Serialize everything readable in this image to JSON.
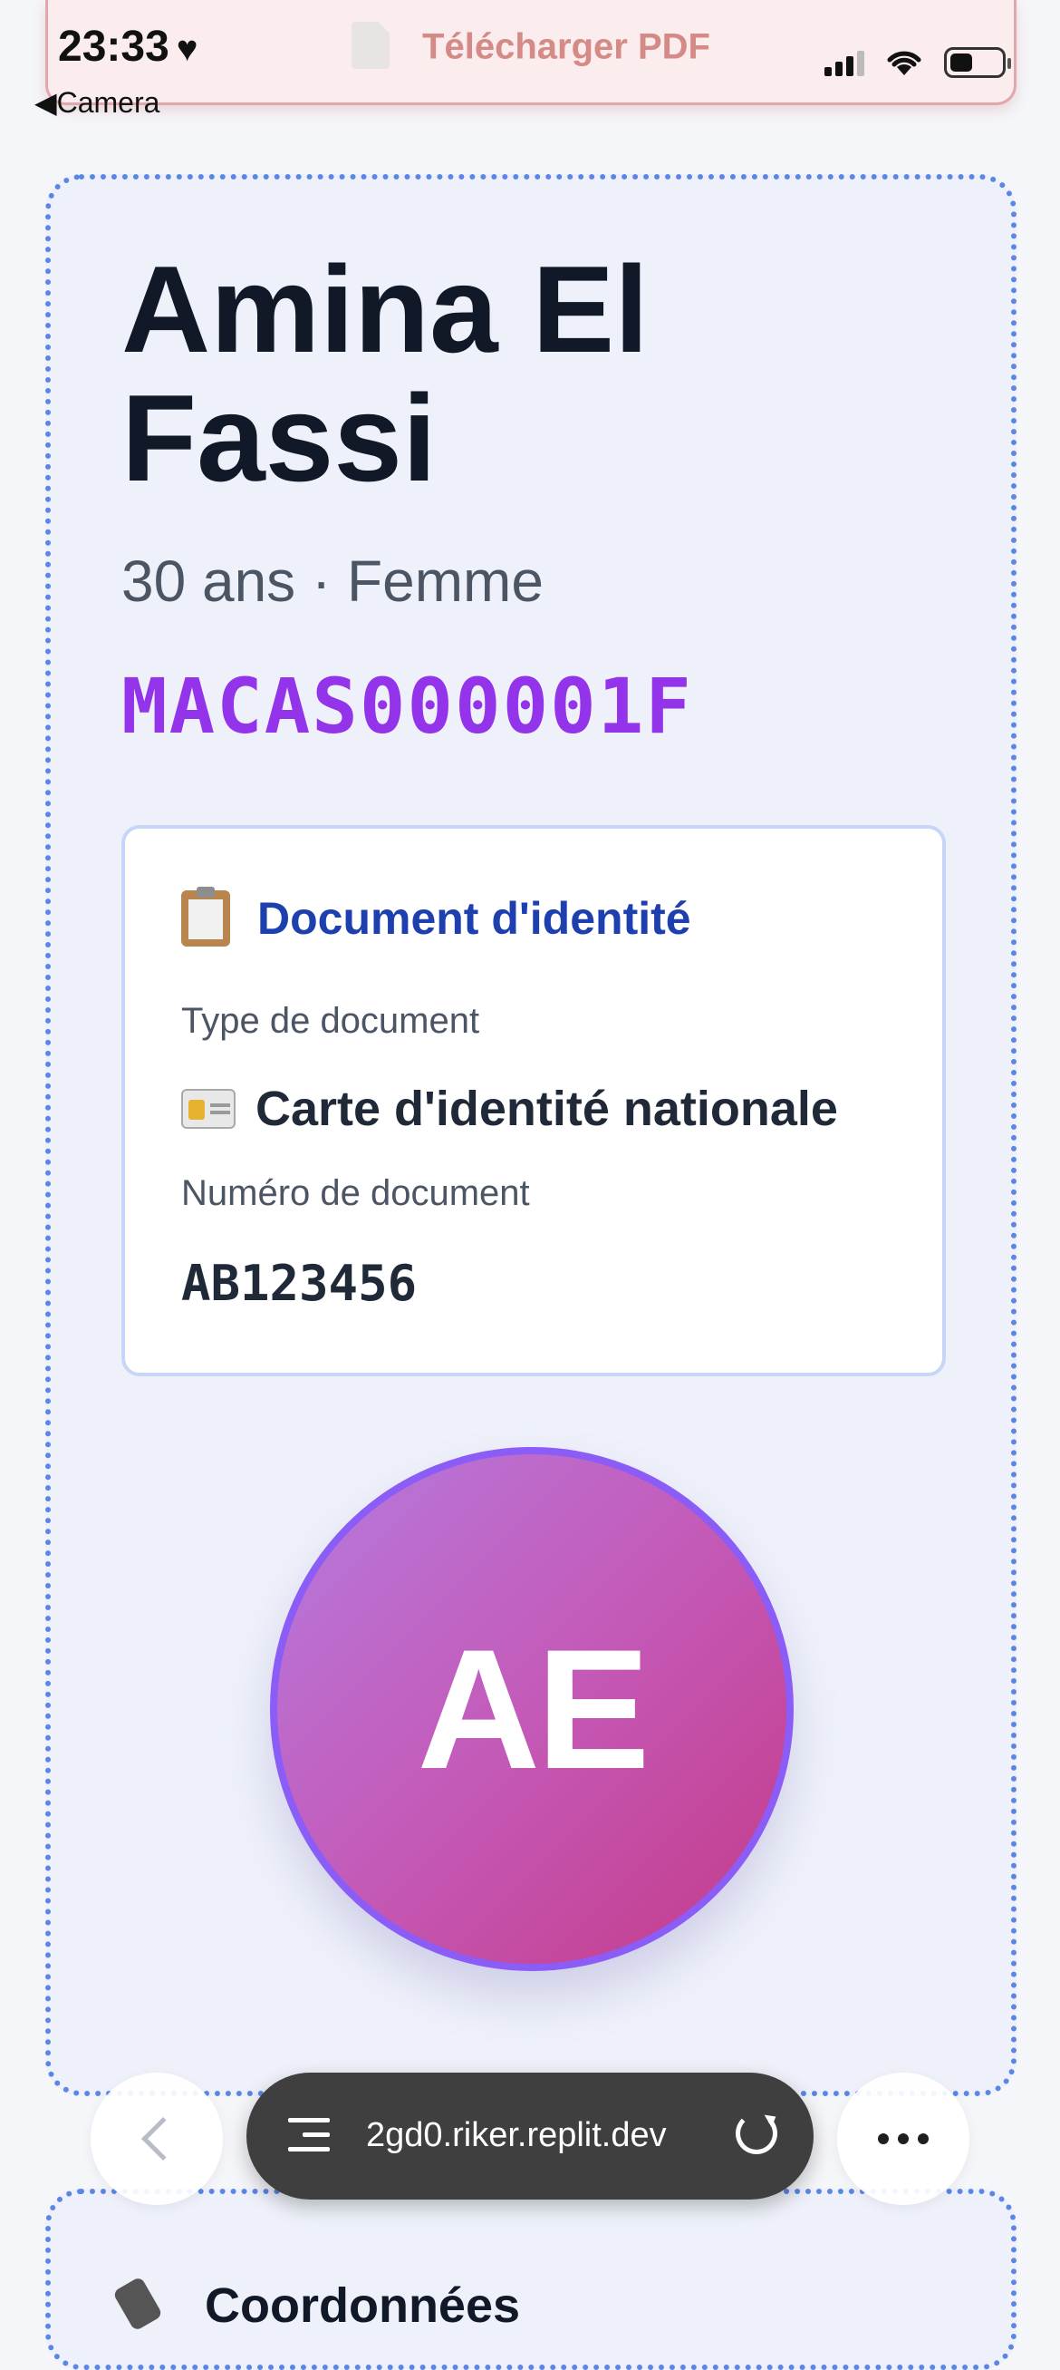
{
  "status_bar": {
    "time": "23:33",
    "back_label": "Camera"
  },
  "pdf_button": {
    "label": "Télécharger PDF"
  },
  "patient": {
    "name": "Amina El Fassi",
    "meta": "30 ans · Femme",
    "patient_id": "MACAS000001F",
    "initials": "AE"
  },
  "document": {
    "title": "Document d'identité",
    "type_label": "Type de document",
    "type_value": "Carte d'identité nationale",
    "number_label": "Numéro de document",
    "number_value": "AB123456"
  },
  "next_section": {
    "label": "Coordonnées"
  },
  "browser": {
    "url": "2gd0.riker.replit.dev"
  },
  "colors": {
    "accent_purple": "#9333ea",
    "doc_title_blue": "#1e40af",
    "card_border": "#5b86e6",
    "pdf_text": "#d48a86"
  },
  "icons": [
    "heart-icon",
    "document-icon",
    "signal-icon",
    "wifi-icon",
    "battery-icon",
    "clipboard-icon",
    "id-card-icon",
    "phone-icon",
    "chevron-left-icon",
    "tabs-icon",
    "reload-icon",
    "more-icon"
  ]
}
